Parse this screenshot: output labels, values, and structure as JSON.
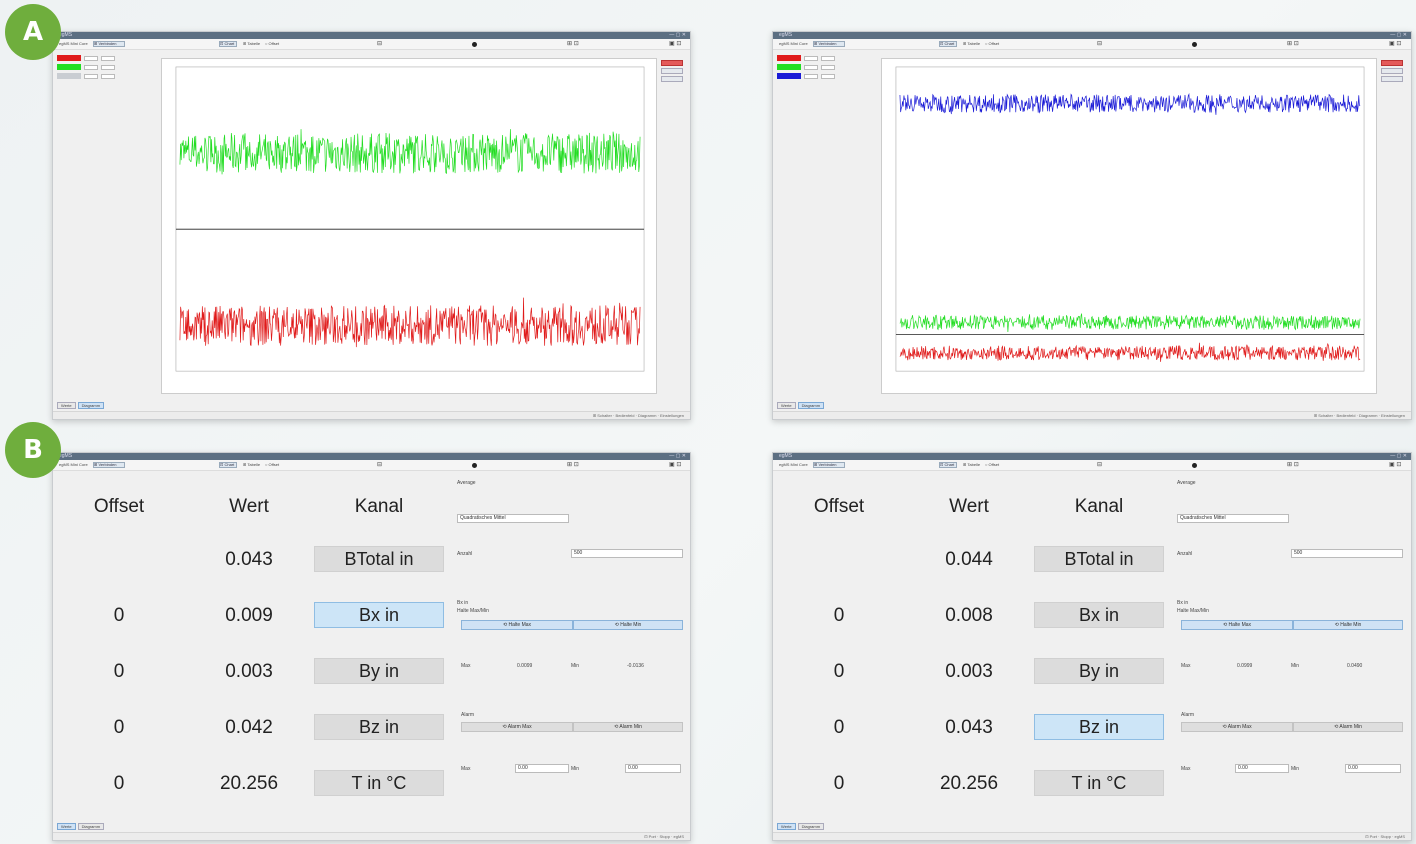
{
  "markers": {
    "a": "A",
    "b": "B"
  },
  "app": {
    "title": "egMS",
    "window_controls": "— ▢ ✕",
    "toolbar": {
      "port": "egMS Mini Core",
      "connect": "⊞ Verbinden",
      "mode1": "⊡ Chart",
      "mode2": "⊞ Tabelle",
      "mode3": "○ Offset",
      "glyph_a": "⊟",
      "glyph_b": "⊞ ⊡",
      "glyph_c": "▣ ⊡"
    },
    "bottom_tabs": {
      "tab1": "Werte",
      "tab2": "Diagramm"
    },
    "status": "⊞ Schalter  ·  Bedienfeld  ·  Diagramm  ·  Einstellungen",
    "status_b": "⊡ Port  ·  Stopp  ·  egMS"
  },
  "colors": {
    "green": "#22dd22",
    "red": "#e01a1a",
    "blue": "#1a1ad6",
    "marker": "#6fae3d"
  },
  "table": {
    "headers": {
      "offset": "Offset",
      "wert": "Wert",
      "kanal": "Kanal"
    },
    "left": {
      "rows": [
        {
          "offset": "",
          "wert": "0.043",
          "kanal": "BTotal in"
        },
        {
          "offset": "0",
          "wert": "0.009",
          "kanal": "Bx in"
        },
        {
          "offset": "0",
          "wert": "0.003",
          "kanal": "By in"
        },
        {
          "offset": "0",
          "wert": "0.042",
          "kanal": "Bz in"
        },
        {
          "offset": "0",
          "wert": "20.256",
          "kanal": "T in °C"
        }
      ],
      "selected": 1
    },
    "right": {
      "rows": [
        {
          "offset": "",
          "wert": "0.044",
          "kanal": "BTotal in"
        },
        {
          "offset": "0",
          "wert": "0.008",
          "kanal": "Bx in"
        },
        {
          "offset": "0",
          "wert": "0.003",
          "kanal": "By in"
        },
        {
          "offset": "0",
          "wert": "0.043",
          "kanal": "Bz in"
        },
        {
          "offset": "0",
          "wert": "20.256",
          "kanal": "T in °C"
        }
      ],
      "selected": 3
    }
  },
  "settings": {
    "average_title": "Average",
    "average_mode": "Quadratisches Mittel",
    "count_label": "Anzahl",
    "count_value": "500",
    "section_channel": "Bx in",
    "section_minmax": "Halte Max/Min",
    "hold_max_btn": "⟲ Halte Max",
    "hold_min_btn": "⟲ Halte Min",
    "max_label": "Max",
    "min_label": "Min",
    "alarm_label": "Alarm",
    "alarm_max_btn": "⟲ Alarm Max",
    "alarm_min_btn": "⟲ Alarm Min",
    "left": {
      "max_value": "0.0099",
      "min_value": "-0.0136",
      "alarm_max": "0.00",
      "alarm_min": "0.00"
    },
    "right": {
      "max_value": "0.0999",
      "min_value": "0.0490",
      "alarm_max": "0.00",
      "alarm_min": "0.00"
    }
  },
  "chart_data": [
    {
      "type": "line",
      "title": "",
      "series": [
        {
          "color": "#22dd22",
          "mean": 0.043,
          "noise": 0.004
        },
        {
          "color": "#e01a1a",
          "mean": 0.009,
          "noise": 0.004
        }
      ],
      "ylim": [
        0.0,
        0.06
      ],
      "grid": false
    },
    {
      "type": "line",
      "title": "",
      "series": [
        {
          "color": "#1a1ad6",
          "mean": 0.044,
          "noise": 0.0015
        },
        {
          "color": "#22dd22",
          "mean": 0.008,
          "noise": 0.0012
        },
        {
          "color": "#e01a1a",
          "mean": 0.003,
          "noise": 0.0012
        }
      ],
      "ylim": [
        0.0,
        0.05
      ],
      "grid": false
    }
  ]
}
